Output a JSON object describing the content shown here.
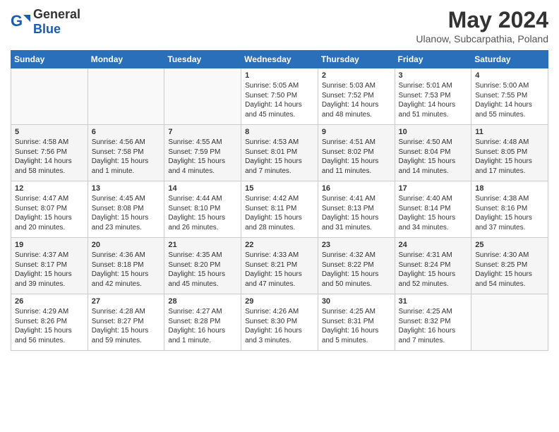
{
  "header": {
    "logo_general": "General",
    "logo_blue": "Blue",
    "month_title": "May 2024",
    "location": "Ulanow, Subcarpathia, Poland"
  },
  "weekdays": [
    "Sunday",
    "Monday",
    "Tuesday",
    "Wednesday",
    "Thursday",
    "Friday",
    "Saturday"
  ],
  "weeks": [
    [
      {
        "day": "",
        "info": ""
      },
      {
        "day": "",
        "info": ""
      },
      {
        "day": "",
        "info": ""
      },
      {
        "day": "1",
        "info": "Sunrise: 5:05 AM\nSunset: 7:50 PM\nDaylight: 14 hours\nand 45 minutes."
      },
      {
        "day": "2",
        "info": "Sunrise: 5:03 AM\nSunset: 7:52 PM\nDaylight: 14 hours\nand 48 minutes."
      },
      {
        "day": "3",
        "info": "Sunrise: 5:01 AM\nSunset: 7:53 PM\nDaylight: 14 hours\nand 51 minutes."
      },
      {
        "day": "4",
        "info": "Sunrise: 5:00 AM\nSunset: 7:55 PM\nDaylight: 14 hours\nand 55 minutes."
      }
    ],
    [
      {
        "day": "5",
        "info": "Sunrise: 4:58 AM\nSunset: 7:56 PM\nDaylight: 14 hours\nand 58 minutes."
      },
      {
        "day": "6",
        "info": "Sunrise: 4:56 AM\nSunset: 7:58 PM\nDaylight: 15 hours\nand 1 minute."
      },
      {
        "day": "7",
        "info": "Sunrise: 4:55 AM\nSunset: 7:59 PM\nDaylight: 15 hours\nand 4 minutes."
      },
      {
        "day": "8",
        "info": "Sunrise: 4:53 AM\nSunset: 8:01 PM\nDaylight: 15 hours\nand 7 minutes."
      },
      {
        "day": "9",
        "info": "Sunrise: 4:51 AM\nSunset: 8:02 PM\nDaylight: 15 hours\nand 11 minutes."
      },
      {
        "day": "10",
        "info": "Sunrise: 4:50 AM\nSunset: 8:04 PM\nDaylight: 15 hours\nand 14 minutes."
      },
      {
        "day": "11",
        "info": "Sunrise: 4:48 AM\nSunset: 8:05 PM\nDaylight: 15 hours\nand 17 minutes."
      }
    ],
    [
      {
        "day": "12",
        "info": "Sunrise: 4:47 AM\nSunset: 8:07 PM\nDaylight: 15 hours\nand 20 minutes."
      },
      {
        "day": "13",
        "info": "Sunrise: 4:45 AM\nSunset: 8:08 PM\nDaylight: 15 hours\nand 23 minutes."
      },
      {
        "day": "14",
        "info": "Sunrise: 4:44 AM\nSunset: 8:10 PM\nDaylight: 15 hours\nand 26 minutes."
      },
      {
        "day": "15",
        "info": "Sunrise: 4:42 AM\nSunset: 8:11 PM\nDaylight: 15 hours\nand 28 minutes."
      },
      {
        "day": "16",
        "info": "Sunrise: 4:41 AM\nSunset: 8:13 PM\nDaylight: 15 hours\nand 31 minutes."
      },
      {
        "day": "17",
        "info": "Sunrise: 4:40 AM\nSunset: 8:14 PM\nDaylight: 15 hours\nand 34 minutes."
      },
      {
        "day": "18",
        "info": "Sunrise: 4:38 AM\nSunset: 8:16 PM\nDaylight: 15 hours\nand 37 minutes."
      }
    ],
    [
      {
        "day": "19",
        "info": "Sunrise: 4:37 AM\nSunset: 8:17 PM\nDaylight: 15 hours\nand 39 minutes."
      },
      {
        "day": "20",
        "info": "Sunrise: 4:36 AM\nSunset: 8:18 PM\nDaylight: 15 hours\nand 42 minutes."
      },
      {
        "day": "21",
        "info": "Sunrise: 4:35 AM\nSunset: 8:20 PM\nDaylight: 15 hours\nand 45 minutes."
      },
      {
        "day": "22",
        "info": "Sunrise: 4:33 AM\nSunset: 8:21 PM\nDaylight: 15 hours\nand 47 minutes."
      },
      {
        "day": "23",
        "info": "Sunrise: 4:32 AM\nSunset: 8:22 PM\nDaylight: 15 hours\nand 50 minutes."
      },
      {
        "day": "24",
        "info": "Sunrise: 4:31 AM\nSunset: 8:24 PM\nDaylight: 15 hours\nand 52 minutes."
      },
      {
        "day": "25",
        "info": "Sunrise: 4:30 AM\nSunset: 8:25 PM\nDaylight: 15 hours\nand 54 minutes."
      }
    ],
    [
      {
        "day": "26",
        "info": "Sunrise: 4:29 AM\nSunset: 8:26 PM\nDaylight: 15 hours\nand 56 minutes."
      },
      {
        "day": "27",
        "info": "Sunrise: 4:28 AM\nSunset: 8:27 PM\nDaylight: 15 hours\nand 59 minutes."
      },
      {
        "day": "28",
        "info": "Sunrise: 4:27 AM\nSunset: 8:28 PM\nDaylight: 16 hours\nand 1 minute."
      },
      {
        "day": "29",
        "info": "Sunrise: 4:26 AM\nSunset: 8:30 PM\nDaylight: 16 hours\nand 3 minutes."
      },
      {
        "day": "30",
        "info": "Sunrise: 4:25 AM\nSunset: 8:31 PM\nDaylight: 16 hours\nand 5 minutes."
      },
      {
        "day": "31",
        "info": "Sunrise: 4:25 AM\nSunset: 8:32 PM\nDaylight: 16 hours\nand 7 minutes."
      },
      {
        "day": "",
        "info": ""
      }
    ]
  ]
}
